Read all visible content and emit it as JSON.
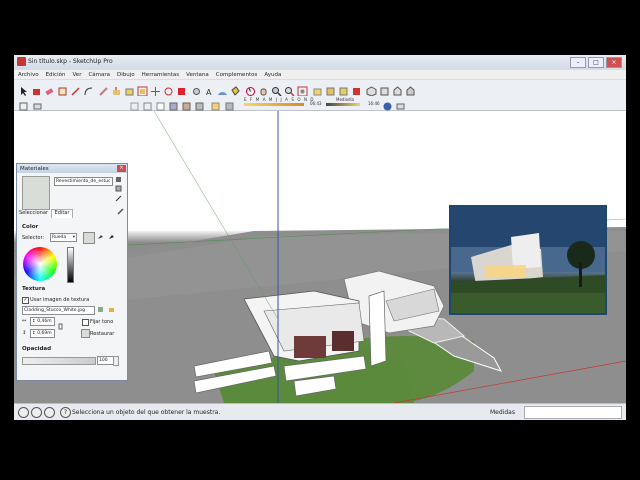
{
  "window": {
    "title": "Sin título.skp - SketchUp Pro"
  },
  "menu": [
    "Archivo",
    "Edición",
    "Ver",
    "Cámara",
    "Dibujo",
    "Herramientas",
    "Ventana",
    "Complementos",
    "Ayuda"
  ],
  "shadows": {
    "months": "E F M A M J J A S O N D",
    "time_start": "06:43",
    "midday": "Mediodía",
    "time_end": "16:46"
  },
  "materials": {
    "title": "Materiales",
    "material_name": "Revestimiento_de_estuc",
    "tabs": {
      "select": "Seleccionar",
      "edit": "Editar"
    },
    "color_label": "Color",
    "selector_label": "Selector:",
    "selector_value": "Rueda",
    "texture_label": "Textura",
    "use_texture_label": "Usar imagen de textura",
    "texture_file": "Cladding_Stucco_White.jpg",
    "width_value": "0,46m",
    "height_value": "0,69m",
    "fix_hue_label": "Fijar tono",
    "restore_label": "Restaurar",
    "opacity_label": "Opacidad",
    "opacity_value": "100"
  },
  "status": {
    "message": "Selecciona un objeto del que obtener la muestra.",
    "measure_label": "Medidas",
    "measure_value": ""
  }
}
